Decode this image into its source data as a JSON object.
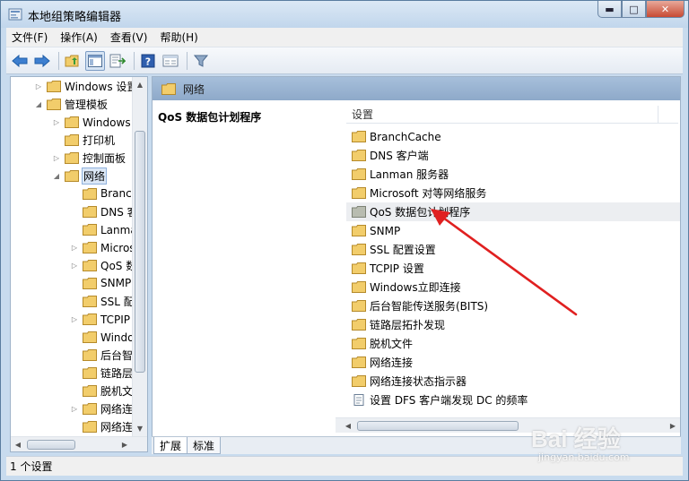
{
  "window": {
    "title": "本地组策略编辑器",
    "min_glyph": "▬",
    "max_glyph": "□",
    "close_glyph": "✕"
  },
  "menubar": {
    "items": [
      "文件(F)",
      "操作(A)",
      "查看(V)",
      "帮助(H)"
    ]
  },
  "toolbar": {
    "icons": [
      "back-icon",
      "forward-icon",
      "up-folder-icon",
      "show-hide-tree-icon",
      "export-list-icon",
      "help-icon",
      "properties-view-icon",
      "filter-icon"
    ],
    "help_glyph": "?"
  },
  "tree": {
    "items": [
      {
        "label": "Windows 设置",
        "expander": "▷"
      },
      {
        "label": "管理模板",
        "expander": "◢"
      },
      {
        "label": "Windows 组件",
        "expander": "▷"
      },
      {
        "label": "打印机",
        "expander": ""
      },
      {
        "label": "控制面板",
        "expander": "▷"
      },
      {
        "label": "网络",
        "expander": "◢"
      },
      {
        "label": "BranchCache",
        "expander": ""
      },
      {
        "label": "DNS 客户端",
        "expander": ""
      },
      {
        "label": "Lanman 服务器",
        "expander": ""
      },
      {
        "label": "Microsoft 对等网络服务",
        "expander": "▷"
      },
      {
        "label": "QoS 数据包计划程序",
        "expander": "▷"
      },
      {
        "label": "SNMP",
        "expander": ""
      },
      {
        "label": "SSL 配置设置",
        "expander": ""
      },
      {
        "label": "TCPIP 设置",
        "expander": "▷"
      },
      {
        "label": "Windows立即连接",
        "expander": ""
      },
      {
        "label": "后台智能传送服务(BITS)",
        "expander": ""
      },
      {
        "label": "链路层拓扑发现",
        "expander": ""
      },
      {
        "label": "脱机文件",
        "expander": ""
      },
      {
        "label": "网络连接",
        "expander": "▷"
      },
      {
        "label": "网络连接状态指示器",
        "expander": ""
      }
    ],
    "selected_index": 5
  },
  "right": {
    "header": "网络",
    "description_title": "QoS 数据包计划程序",
    "column_header": "设置",
    "items": [
      {
        "label": "BranchCache",
        "icon": "folder-icon"
      },
      {
        "label": "DNS 客户端",
        "icon": "folder-icon"
      },
      {
        "label": "Lanman 服务器",
        "icon": "folder-icon"
      },
      {
        "label": "Microsoft 对等网络服务",
        "icon": "folder-icon"
      },
      {
        "label": "QoS 数据包计划程序",
        "icon": "folder-icon"
      },
      {
        "label": "SNMP",
        "icon": "folder-icon"
      },
      {
        "label": "SSL 配置设置",
        "icon": "folder-icon"
      },
      {
        "label": "TCPIP 设置",
        "icon": "folder-icon"
      },
      {
        "label": "Windows立即连接",
        "icon": "folder-icon"
      },
      {
        "label": "后台智能传送服务(BITS)",
        "icon": "folder-icon"
      },
      {
        "label": "链路层拓扑发现",
        "icon": "folder-icon"
      },
      {
        "label": "脱机文件",
        "icon": "folder-icon"
      },
      {
        "label": "网络连接",
        "icon": "folder-icon"
      },
      {
        "label": "网络连接状态指示器",
        "icon": "folder-icon"
      },
      {
        "label": "设置 DFS 客户端发现 DC 的频率",
        "icon": "setting-icon"
      }
    ],
    "hovered_index": 4
  },
  "scroll": {
    "up": "▲",
    "down": "▼",
    "left": "◀",
    "right": "▶"
  },
  "tabs": {
    "items": [
      "扩展",
      "标准"
    ],
    "active_index": 0
  },
  "status": {
    "text": "1 个设置"
  },
  "watermark": {
    "text": "Bai 经验",
    "sub": "jingyan.baidu.com"
  },
  "colors": {
    "folder": "#f2cd6b",
    "folder_grey": "#b8bcb0",
    "annotation_arrow": "#e02020",
    "header": "#9bb5d4"
  }
}
